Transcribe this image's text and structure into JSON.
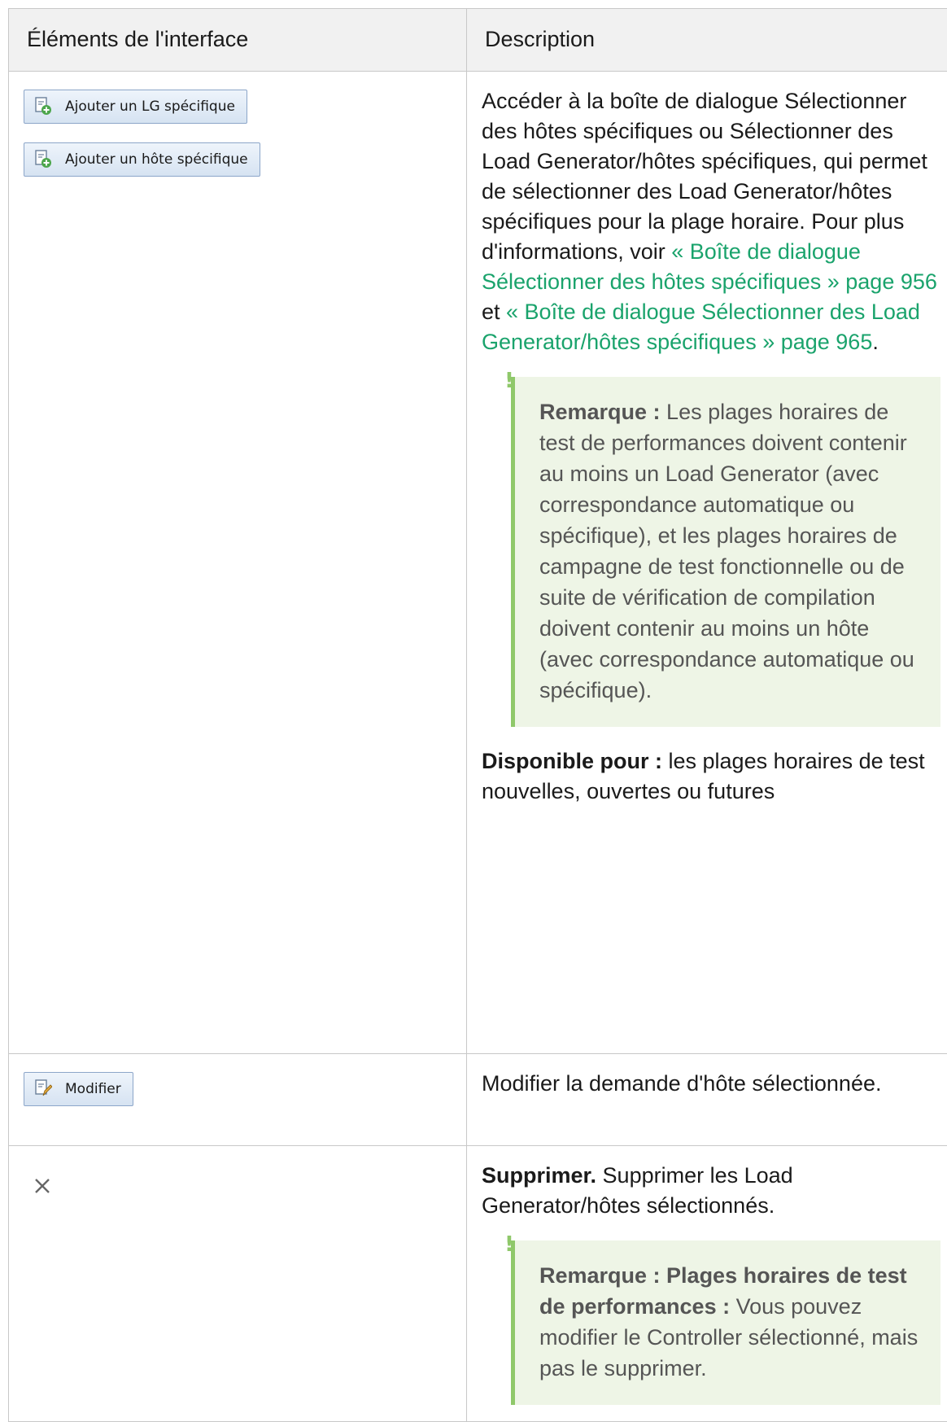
{
  "table": {
    "headers": {
      "col1": "Éléments de l'interface",
      "col2": "Description"
    }
  },
  "rows": [
    {
      "buttons": [
        {
          "label": "Ajouter un LG spécifique",
          "icon": "add-document-icon"
        },
        {
          "label": "Ajouter un hôte spécifique",
          "icon": "add-document-icon"
        }
      ],
      "description": {
        "text_before": "Accéder à la boîte de dialogue Sélectionner des hôtes spécifiques ou Sélectionner des Load Generator/hôtes spécifiques, qui permet de sélectionner des Load Generator/hôtes spécifiques pour la plage horaire. Pour plus d'informations, voir ",
        "link1": "« Boîte de dialogue Sélectionner des hôtes spécifiques » page 956",
        "between": " et ",
        "link2": "« Boîte de dialogue Sélectionner des Load Generator/hôtes spécifiques » page 965",
        "after": "."
      },
      "note": {
        "mark": "!",
        "label": "Remarque :",
        "text": " Les plages horaires de test de performances doivent contenir au moins un Load Generator (avec correspondance automatique ou spécifique), et les plages horaires de campagne de test fonctionnelle ou de suite de vérification de compilation doivent contenir au moins un hôte (avec correspondance automatique ou spécifique)."
      },
      "availability": {
        "label": "Disponible pour :",
        "text": " les plages horaires de test nouvelles, ouvertes ou futures"
      }
    },
    {
      "button": {
        "label": "Modifier",
        "icon": "edit-document-icon"
      },
      "description": "Modifier la demande d'hôte sélectionnée."
    },
    {
      "icon": "close-icon",
      "description": {
        "label": "Supprimer.",
        "text": " Supprimer les Load Generator/hôtes sélectionnés."
      },
      "note": {
        "mark": "!",
        "label": "Remarque : Plages horaires de test de performances :",
        "text": " Vous pouvez modifier le Controller sélectionné, mais pas le supprimer."
      }
    }
  ],
  "colors": {
    "link": "#1aa36c",
    "note_bg": "#eef5e6",
    "note_bar": "#8fc86a",
    "header_bg": "#f1f1f1"
  }
}
